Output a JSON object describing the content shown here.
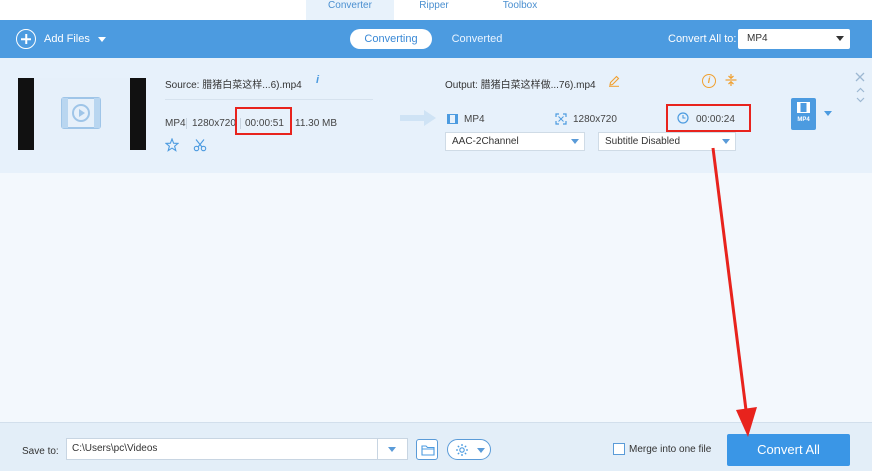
{
  "top_tabs": [
    {
      "label": "Converter"
    },
    {
      "label": "Ripper"
    },
    {
      "label": "Toolbox"
    }
  ],
  "toolbar": {
    "add_files": "Add Files",
    "modes": [
      "Converting",
      "Converted"
    ],
    "convert_all_to_label": "Convert All to:",
    "format_value": "MP4"
  },
  "file": {
    "source_label": "Source: 腊猪白菜这样...6).mp4",
    "src_format": "MP4",
    "src_resolution": "1280x720",
    "src_duration": "00:00:51",
    "src_size": "11.30 MB",
    "output_label": "Output: 腊猪白菜这样做...76).mp4",
    "out_format": "MP4",
    "out_resolution": "1280x720",
    "out_duration": "00:00:24",
    "audio_track": "AAC-2Channel",
    "subtitle": "Subtitle Disabled",
    "format_badge": "MP4"
  },
  "bottom": {
    "save_to_label": "Save to:",
    "save_path": "C:\\Users\\pc\\Videos",
    "merge_label": "Merge into one file",
    "convert_all": "Convert All"
  },
  "colors": {
    "accent": "#4c9be0",
    "convert_button": "#3a96e6",
    "highlight": "#e8231d"
  }
}
